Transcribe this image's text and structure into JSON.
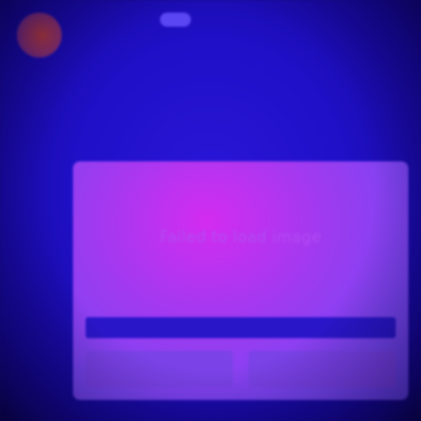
{
  "post": {
    "username": "",
    "tag": "",
    "subtitle": "",
    "body_lines": [
      "",
      "",
      "",
      "",
      ""
    ]
  },
  "image_card": {
    "error_text": "Failed to load image",
    "caption": "",
    "actions": [
      {
        "label": ""
      },
      {
        "label": ""
      }
    ]
  },
  "colors": {
    "background": "#1a0a8f",
    "accent": "#2010c8",
    "card": "#a03af0",
    "avatar": "#b23a3a"
  }
}
